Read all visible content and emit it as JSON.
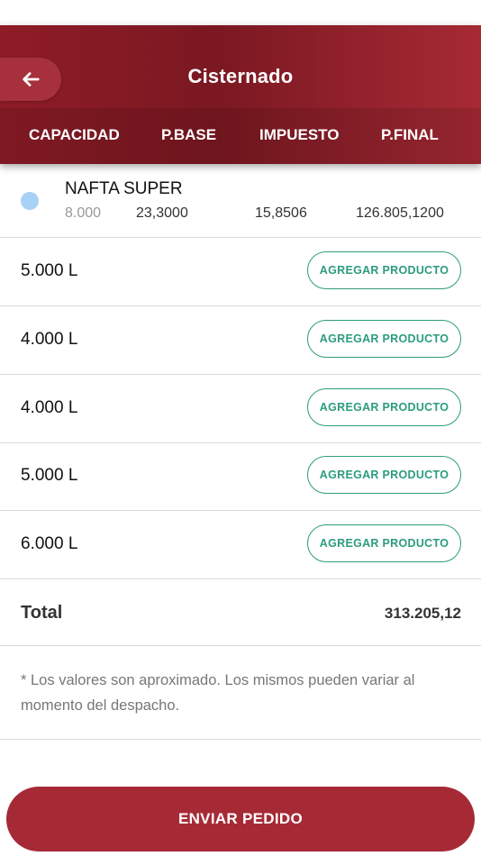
{
  "header": {
    "title": "Cisternado",
    "columns": [
      "CAPACIDAD",
      "P.BASE",
      "IMPUESTO",
      "P.FINAL"
    ]
  },
  "product": {
    "name": "NAFTA SUPER",
    "capacity": "8.000",
    "base_price": "23,3000",
    "tax": "15,8506",
    "final_price": "126.805,1200",
    "dot_color": "#a9d1f5"
  },
  "capacities": [
    {
      "label": "5.000 L",
      "button": "AGREGAR PRODUCTO"
    },
    {
      "label": "4.000 L",
      "button": "AGREGAR PRODUCTO"
    },
    {
      "label": "4.000 L",
      "button": "AGREGAR PRODUCTO"
    },
    {
      "label": "5.000 L",
      "button": "AGREGAR PRODUCTO"
    },
    {
      "label": "6.000 L",
      "button": "AGREGAR PRODUCTO"
    }
  ],
  "total": {
    "label": "Total",
    "value": "313.205,12"
  },
  "disclaimer": "* Los valores son aproximado. Los mismos pueden variar al momento del despacho.",
  "send_button": "ENVIAR PEDIDO",
  "colors": {
    "brand": "#8e1c27",
    "button": "#a62a36",
    "accent_green": "#2c9c7d"
  },
  "icons": {
    "back": "arrow-left-icon"
  }
}
